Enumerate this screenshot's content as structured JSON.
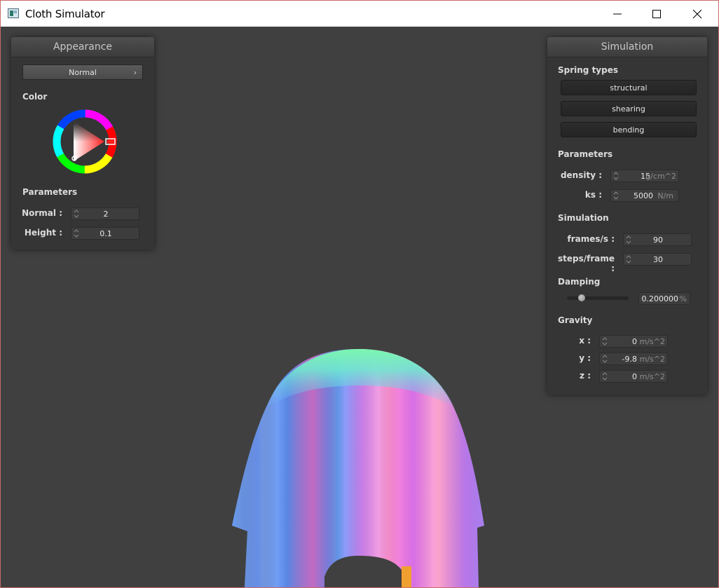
{
  "window": {
    "title": "Cloth Simulator",
    "buttons": {
      "minimize": "minimize-icon",
      "maximize": "maximize-icon",
      "close": "close-icon"
    }
  },
  "appearance": {
    "title": "Appearance",
    "shader": {
      "value": "Normal",
      "chevron": "›"
    },
    "color_label": "Color",
    "color_wheel": {
      "hue_color": "#ff2020"
    },
    "parameters_label": "Parameters",
    "params": [
      {
        "label": "Normal :",
        "value": "2"
      },
      {
        "label": "Height :",
        "value": "0.1"
      }
    ]
  },
  "simulation": {
    "title": "Simulation",
    "spring_types_label": "Spring types",
    "springs": [
      "structural",
      "shearing",
      "bending"
    ],
    "parameters_label": "Parameters",
    "density": {
      "label": "density :",
      "value": "15",
      "unit": "g/cm^2"
    },
    "ks": {
      "label": "ks :",
      "value": "5000",
      "unit": "N/m"
    },
    "simulation_label": "Simulation",
    "frames": {
      "label": "frames/s :",
      "value": "90"
    },
    "steps": {
      "label": "steps/frame :",
      "value": "30"
    },
    "damping_label": "Damping",
    "damping": {
      "value": "0.200000",
      "unit": "%",
      "slider_fraction": 0.2
    },
    "gravity_label": "Gravity",
    "gravity": [
      {
        "label": "x :",
        "value": "0",
        "unit": "m/s^2"
      },
      {
        "label": "y :",
        "value": "-9.8",
        "unit": "m/s^2"
      },
      {
        "label": "z :",
        "value": "0",
        "unit": "m/s^2"
      }
    ]
  },
  "colors": {
    "background": "#404040",
    "panel": "#353535",
    "field": "#3d3d3d"
  }
}
